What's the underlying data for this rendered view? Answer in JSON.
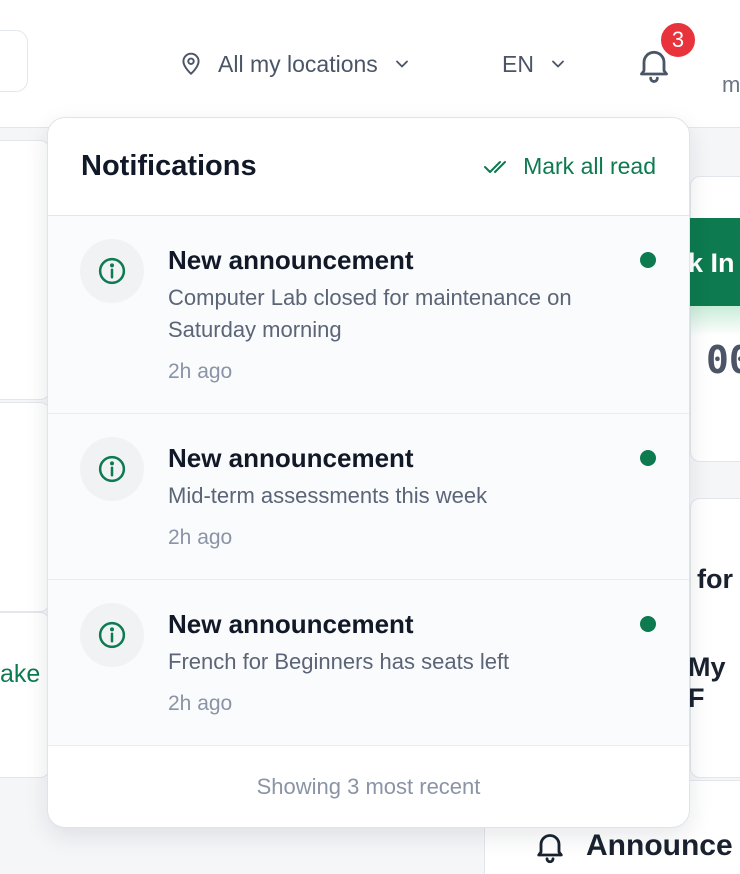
{
  "topbar": {
    "location_label": "All my locations",
    "language_label": "EN",
    "notification_count": "3",
    "user_stub": "m"
  },
  "background": {
    "button_fragment": "k In",
    "timer_fragment": "00",
    "text_for": "for",
    "text_my": "My F",
    "text_ake": "ake",
    "announcements_fragment": "Announce"
  },
  "notifications": {
    "title": "Notifications",
    "mark_all_label": "Mark all read",
    "items": [
      {
        "title": "New announcement",
        "message": "Computer Lab closed for maintenance on Saturday morning",
        "time": "2h ago",
        "unread": true
      },
      {
        "title": "New announcement",
        "message": "Mid-term assessments this week",
        "time": "2h ago",
        "unread": true
      },
      {
        "title": "New announcement",
        "message": "French for Beginners has seats left",
        "time": "2h ago",
        "unread": true
      }
    ],
    "footer": "Showing 3 most recent"
  },
  "colors": {
    "accent": "#0d7a4f",
    "badge": "#e8333d"
  }
}
